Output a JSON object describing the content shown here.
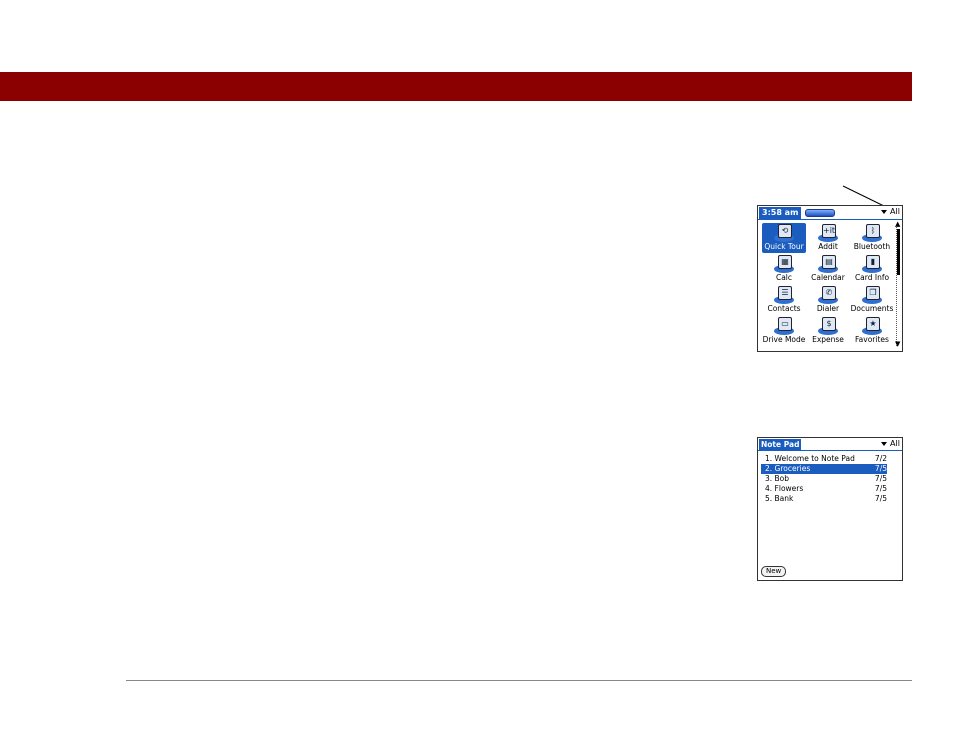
{
  "launcher": {
    "time": "3:58 am",
    "category": "All",
    "apps": [
      {
        "name": "Quick Tour",
        "icon": "quick-tour-icon",
        "glyph": "⟲",
        "selected": true
      },
      {
        "name": "Addit",
        "icon": "addit-icon",
        "glyph": "+it",
        "selected": false
      },
      {
        "name": "Bluetooth",
        "icon": "bluetooth-icon",
        "glyph": "ᛒ",
        "selected": false
      },
      {
        "name": "Calc",
        "icon": "calc-icon",
        "glyph": "▦",
        "selected": false
      },
      {
        "name": "Calendar",
        "icon": "calendar-icon",
        "glyph": "▤",
        "selected": false
      },
      {
        "name": "Card Info",
        "icon": "card-info-icon",
        "glyph": "▮",
        "selected": false
      },
      {
        "name": "Contacts",
        "icon": "contacts-icon",
        "glyph": "☰",
        "selected": false
      },
      {
        "name": "Dialer",
        "icon": "dialer-icon",
        "glyph": "✆",
        "selected": false
      },
      {
        "name": "Documents",
        "icon": "documents-icon",
        "glyph": "❐",
        "selected": false
      },
      {
        "name": "Drive Mode",
        "icon": "drive-mode-icon",
        "glyph": "▭",
        "selected": false
      },
      {
        "name": "Expense",
        "icon": "expense-icon",
        "glyph": "$",
        "selected": false
      },
      {
        "name": "Favorites",
        "icon": "favorites-icon",
        "glyph": "★",
        "selected": false
      }
    ]
  },
  "notepad": {
    "title": "Note Pad",
    "category": "All",
    "notes": [
      {
        "title": "1. Welcome to Note Pad",
        "date": "7/2",
        "selected": false
      },
      {
        "title": "2. Groceries",
        "date": "7/5",
        "selected": true
      },
      {
        "title": "3. Bob",
        "date": "7/5",
        "selected": false
      },
      {
        "title": "4. Flowers",
        "date": "7/5",
        "selected": false
      },
      {
        "title": "5. Bank",
        "date": "7/5",
        "selected": false
      }
    ],
    "new_label": "New"
  },
  "colors": {
    "banner": "#8b0000",
    "highlight": "#1a5dbf"
  }
}
